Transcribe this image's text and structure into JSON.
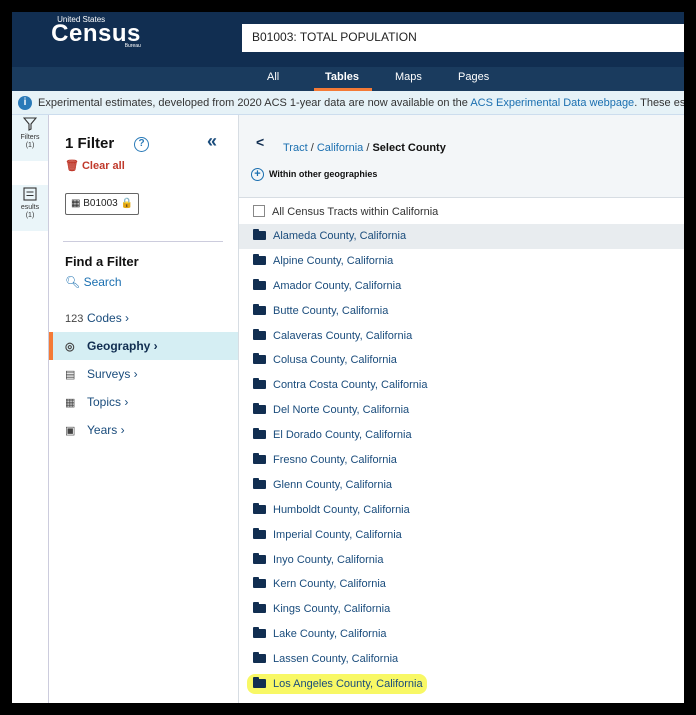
{
  "header": {
    "logo": {
      "top": "United States",
      "main": "Census",
      "sub": "Bureau"
    },
    "title": "B01003: TOTAL POPULATION"
  },
  "nav": {
    "items": [
      "All",
      "Tables",
      "Maps",
      "Pages"
    ],
    "active": "Tables"
  },
  "banner": {
    "text": "Experimental estimates, developed from 2020 ACS 1-year data are now available on the ",
    "link": "ACS Experimental Data webpage",
    "text_after": ". These estimat"
  },
  "rail": {
    "filters_label": "Filters",
    "filters_count": "(1)",
    "results_label": "esults",
    "results_count": "(1)"
  },
  "filter_panel": {
    "title": "1 Filter",
    "help": "?",
    "collapse": "«",
    "clear_all": "Clear all",
    "chip": "B01003",
    "find_title": "Find a Filter",
    "search": "Search",
    "menu": [
      {
        "icon": "123",
        "label": "Codes  ›"
      },
      {
        "icon": "◎",
        "label": "Geography  ›"
      },
      {
        "icon": "▤",
        "label": "Surveys  ›"
      },
      {
        "icon": "▦",
        "label": "Topics  ›"
      },
      {
        "icon": "▣",
        "label": "Years  ›"
      }
    ]
  },
  "breadcrumb": {
    "tract": "Tract",
    "state": "California",
    "current": "Select County",
    "sep": " / "
  },
  "within_label": "Within other geographies",
  "all_tracts_label": "All Census Tracts within California",
  "counties": [
    "Alameda County, California",
    "Alpine County, California",
    "Amador County, California",
    "Butte County, California",
    "Calaveras County, California",
    "Colusa County, California",
    "Contra Costa County, California",
    "Del Norte County, California",
    "El Dorado County, California",
    "Fresno County, California",
    "Glenn County, California",
    "Humboldt County, California",
    "Imperial County, California",
    "Inyo County, California",
    "Kern County, California",
    "Kings County, California",
    "Lake County, California",
    "Lassen County, California",
    "Los Angeles County, California"
  ]
}
